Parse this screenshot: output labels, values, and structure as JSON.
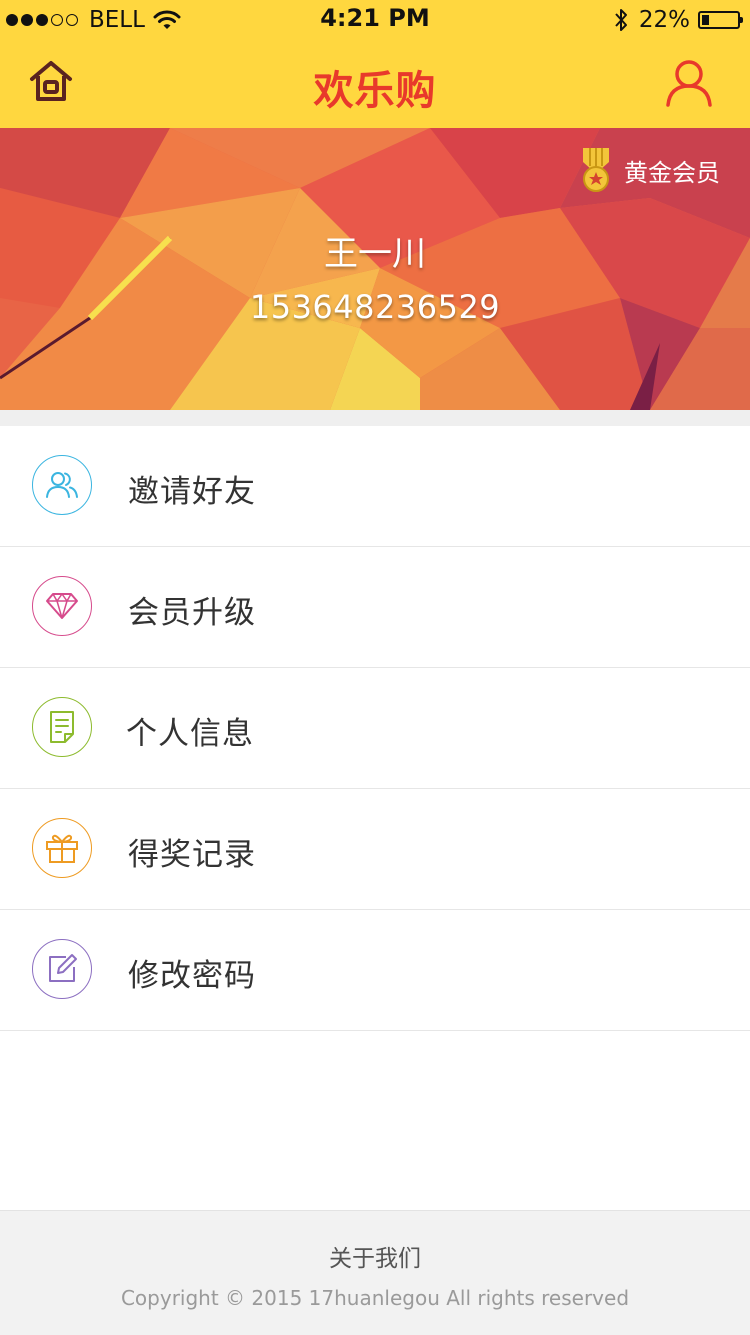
{
  "status_bar": {
    "carrier": "BELL",
    "time": "4:21 PM",
    "battery": "22%",
    "battery_level": 0.22,
    "signal_dots_filled": 3,
    "signal_dots_total": 5
  },
  "nav": {
    "title": "欢乐购",
    "home_icon": "home-icon",
    "user_icon": "user-icon"
  },
  "profile": {
    "membership": "黄金会员",
    "name": "王一川",
    "phone": "153648236529"
  },
  "menu": [
    {
      "label": "邀请好友",
      "icon": "friends-icon",
      "color": "#3BB5E0"
    },
    {
      "label": "会员升级",
      "icon": "diamond-icon",
      "color": "#D64B8C"
    },
    {
      "label": "个人信息",
      "icon": "document-icon",
      "color": "#8DBB2E"
    },
    {
      "label": "得奖记录",
      "icon": "gift-icon",
      "color": "#EE9B22"
    },
    {
      "label": "修改密码",
      "icon": "edit-icon",
      "color": "#8C6FC1"
    }
  ],
  "footer": {
    "about": "关于我们",
    "copyright": "Copyright © 2015 17huanlegou All rights reserved"
  },
  "colors": {
    "header_bg": "#FFD73F",
    "title_red": "#E8392B"
  }
}
